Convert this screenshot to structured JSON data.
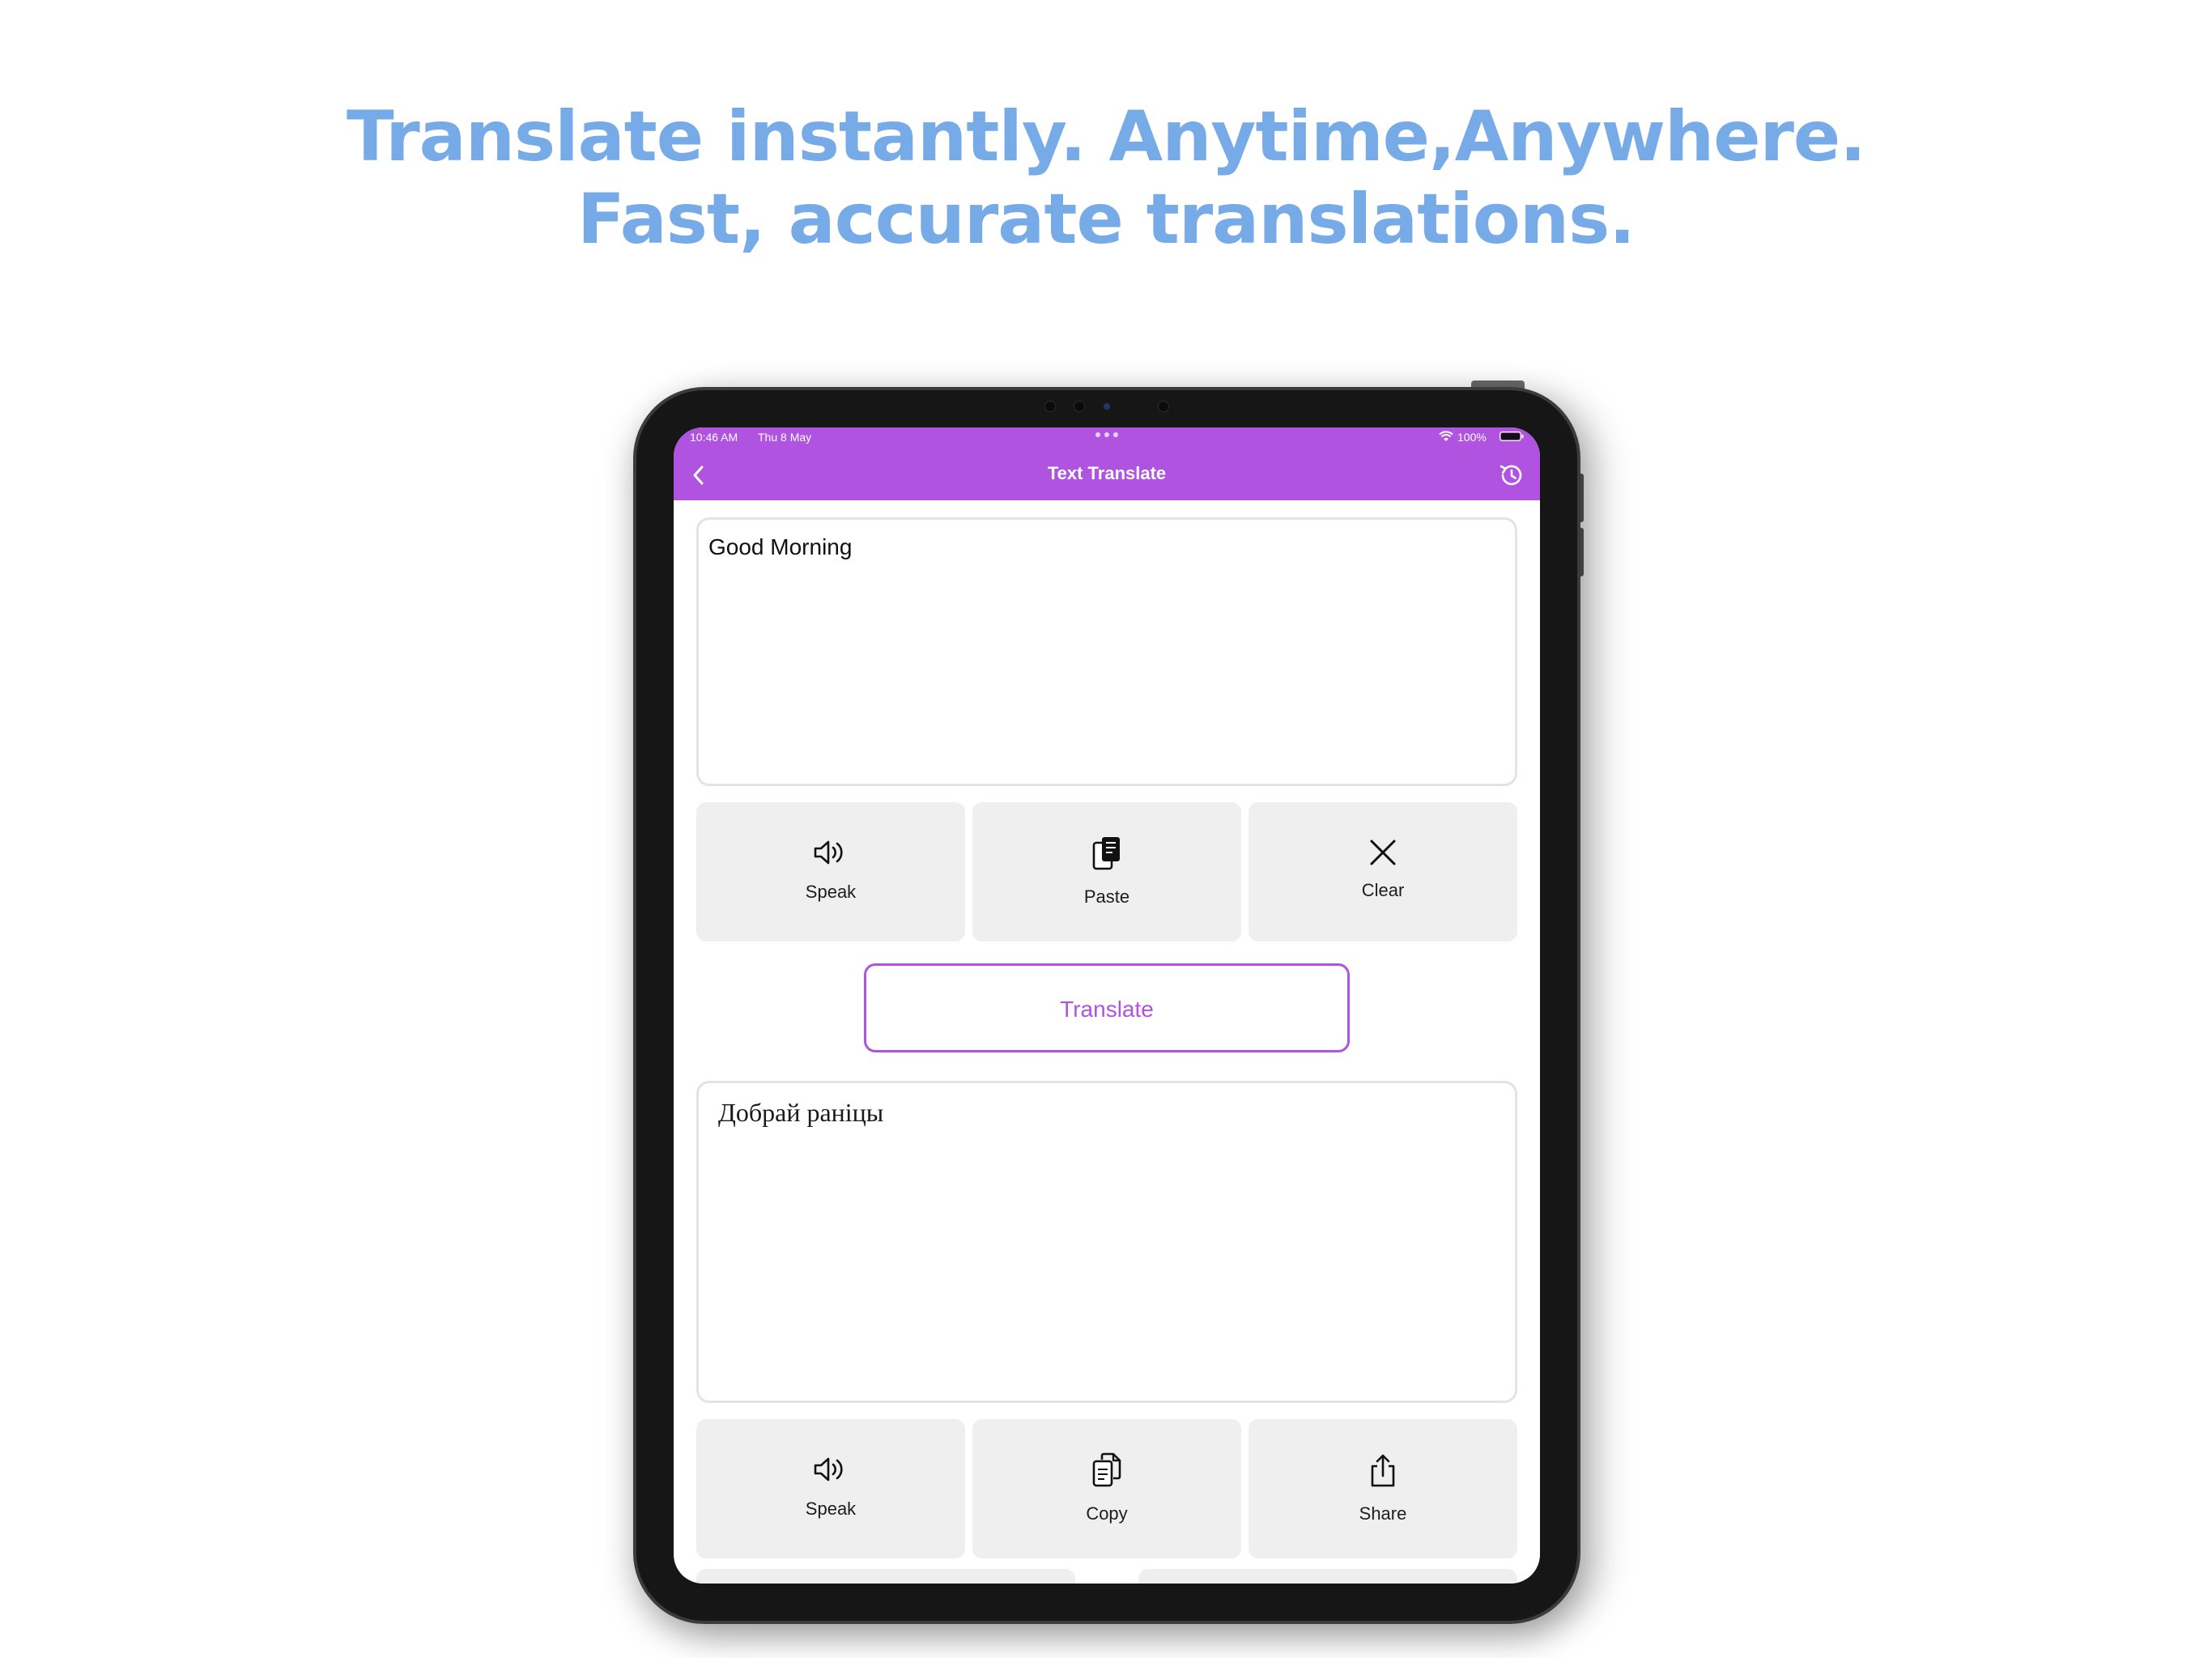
{
  "headline": {
    "line1": "Translate instantly. Anytime,Anywhere.",
    "line2": "Fast, accurate translations."
  },
  "status_bar": {
    "time": "10:46 AM",
    "date": "Thu 8 May",
    "battery": "100%"
  },
  "nav": {
    "title": "Text Translate",
    "back_icon": "chevron-left-icon",
    "history_icon": "history-clock-icon"
  },
  "input": {
    "value": "Good Morning"
  },
  "input_actions": [
    {
      "label": "Speak",
      "icon": "speaker-icon"
    },
    {
      "label": "Paste",
      "icon": "paste-icon"
    },
    {
      "label": "Clear",
      "icon": "close-icon"
    }
  ],
  "translate_button": {
    "label": "Translate"
  },
  "output": {
    "value": "Добрай раніцы"
  },
  "output_actions": [
    {
      "label": "Speak",
      "icon": "speaker-icon"
    },
    {
      "label": "Copy",
      "icon": "copy-icon"
    },
    {
      "label": "Share",
      "icon": "share-icon"
    }
  ],
  "colors": {
    "headline": "#76abe8",
    "accent": "#b053e0",
    "button_bg": "#efefef",
    "device_frame": "#161616"
  }
}
